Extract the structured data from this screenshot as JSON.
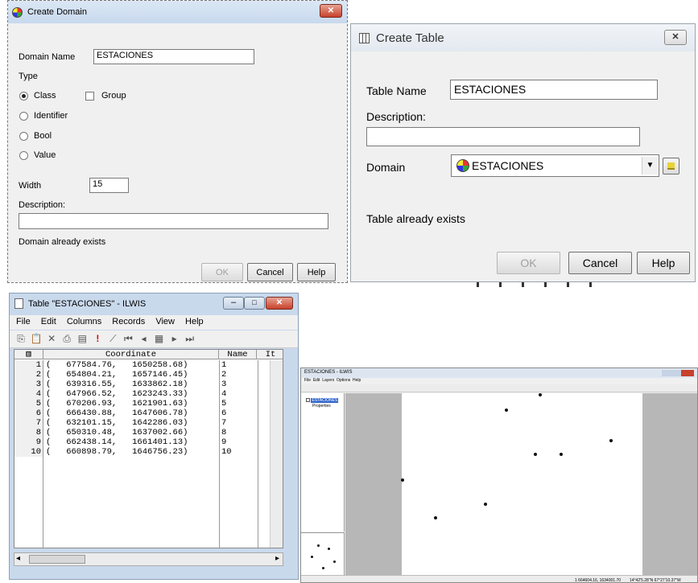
{
  "create_domain": {
    "title": "Create Domain",
    "close_glyph": "✕",
    "domain_name_label": "Domain Name",
    "domain_name_value": "ESTACIONES",
    "type_label": "Type",
    "type_options": [
      "Class",
      "Identifier",
      "Bool",
      "Value"
    ],
    "group_label": "Group",
    "width_label": "Width",
    "width_value": "15",
    "description_label": "Description:",
    "description_value": "",
    "status": "Domain already exists",
    "ok_label": "OK",
    "cancel_label": "Cancel",
    "help_label": "Help"
  },
  "create_table": {
    "title": "Create Table",
    "close_glyph": "✕",
    "table_name_label": "Table Name",
    "table_name_value": "ESTACIONES",
    "description_label": "Description:",
    "description_value": "",
    "domain_label": "Domain",
    "domain_value": "ESTACIONES",
    "status": "Table already exists",
    "ok_label": "OK",
    "cancel_label": "Cancel",
    "help_label": "Help"
  },
  "table_window": {
    "title": "Table \"ESTACIONES\" - ILWIS",
    "menu": [
      "File",
      "Edit",
      "Columns",
      "Records",
      "View",
      "Help"
    ],
    "columns": [
      "Coordinate",
      "Name",
      "It"
    ],
    "rows": [
      {
        "n": "1",
        "coordinate": "(   677584.76,   1650258.68)",
        "name": "1"
      },
      {
        "n": "2",
        "coordinate": "(   654804.21,   1657146.45)",
        "name": "2"
      },
      {
        "n": "3",
        "coordinate": "(   639316.55,   1633862.18)",
        "name": "3"
      },
      {
        "n": "4",
        "coordinate": "(   647966.52,   1623243.33)",
        "name": "4"
      },
      {
        "n": "5",
        "coordinate": "(   670206.93,   1621901.63)",
        "name": "5"
      },
      {
        "n": "6",
        "coordinate": "(   666430.88,   1647606.78)",
        "name": "6"
      },
      {
        "n": "7",
        "coordinate": "(   632101.15,   1642286.03)",
        "name": "7"
      },
      {
        "n": "8",
        "coordinate": "(   650310.48,   1637002.66)",
        "name": "8"
      },
      {
        "n": "9",
        "coordinate": "(   662438.14,   1661401.13)",
        "name": "9"
      },
      {
        "n": "10",
        "coordinate": "(   660898.79,   1646756.23)",
        "name": "10"
      }
    ]
  },
  "map_window": {
    "title": "ESTACIONES - ILWIS",
    "menu": "File  Edit  Layers  Options  Help",
    "tree_item": "ESTACIONES",
    "tree_sub": "Properties",
    "status_left": "1 664604.16, 1634001.70",
    "status_right": "14°42'5.28\"N 67°27'10.37\"W"
  },
  "colors": {
    "titlebar": "#dbe7f4",
    "close_red": "#c7412b",
    "dialog_bg": "#f0f0f0",
    "map_grey": "#b7b7b7"
  }
}
